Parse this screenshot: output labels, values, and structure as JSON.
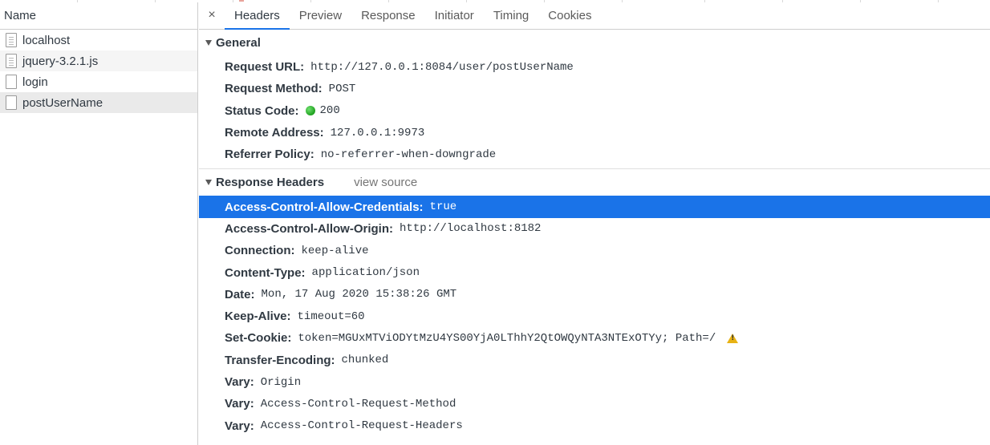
{
  "left": {
    "column_header": "Name",
    "requests": [
      {
        "name": "localhost",
        "icon": "document-icon"
      },
      {
        "name": "jquery-3.2.1.js",
        "icon": "document-icon"
      },
      {
        "name": "login",
        "icon": "blank-file-icon"
      },
      {
        "name": "postUserName",
        "icon": "blank-file-icon"
      }
    ]
  },
  "tabs": {
    "close": "×",
    "items": [
      "Headers",
      "Preview",
      "Response",
      "Initiator",
      "Timing",
      "Cookies"
    ],
    "active": "Headers"
  },
  "general": {
    "title": "General",
    "rows": [
      {
        "key": "Request URL:",
        "value": "http://127.0.0.1:8084/user/postUserName"
      },
      {
        "key": "Request Method:",
        "value": "POST"
      },
      {
        "key": "Status Code:",
        "value": "200"
      },
      {
        "key": "Remote Address:",
        "value": "127.0.0.1:9973"
      },
      {
        "key": "Referrer Policy:",
        "value": "no-referrer-when-downgrade"
      }
    ]
  },
  "response_headers": {
    "title": "Response Headers",
    "view_source": "view source",
    "rows": [
      {
        "key": "Access-Control-Allow-Credentials:",
        "value": "true"
      },
      {
        "key": "Access-Control-Allow-Origin:",
        "value": "http://localhost:8182"
      },
      {
        "key": "Connection:",
        "value": "keep-alive"
      },
      {
        "key": "Content-Type:",
        "value": "application/json"
      },
      {
        "key": "Date:",
        "value": "Mon, 17 Aug 2020 15:38:26 GMT"
      },
      {
        "key": "Keep-Alive:",
        "value": "timeout=60"
      },
      {
        "key": "Set-Cookie:",
        "value": "token=MGUxMTViODYtMzU4YS00YjA0LThhY2QtOWQyNTA3NTExOTYy; Path=/"
      },
      {
        "key": "Transfer-Encoding:",
        "value": "chunked"
      },
      {
        "key": "Vary:",
        "value": "Origin"
      },
      {
        "key": "Vary:",
        "value": "Access-Control-Request-Method"
      },
      {
        "key": "Vary:",
        "value": "Access-Control-Request-Headers"
      }
    ]
  },
  "colors": {
    "selection": "#1a73e8",
    "status_ok": "#1ea01e",
    "warning": "#e8b214"
  }
}
